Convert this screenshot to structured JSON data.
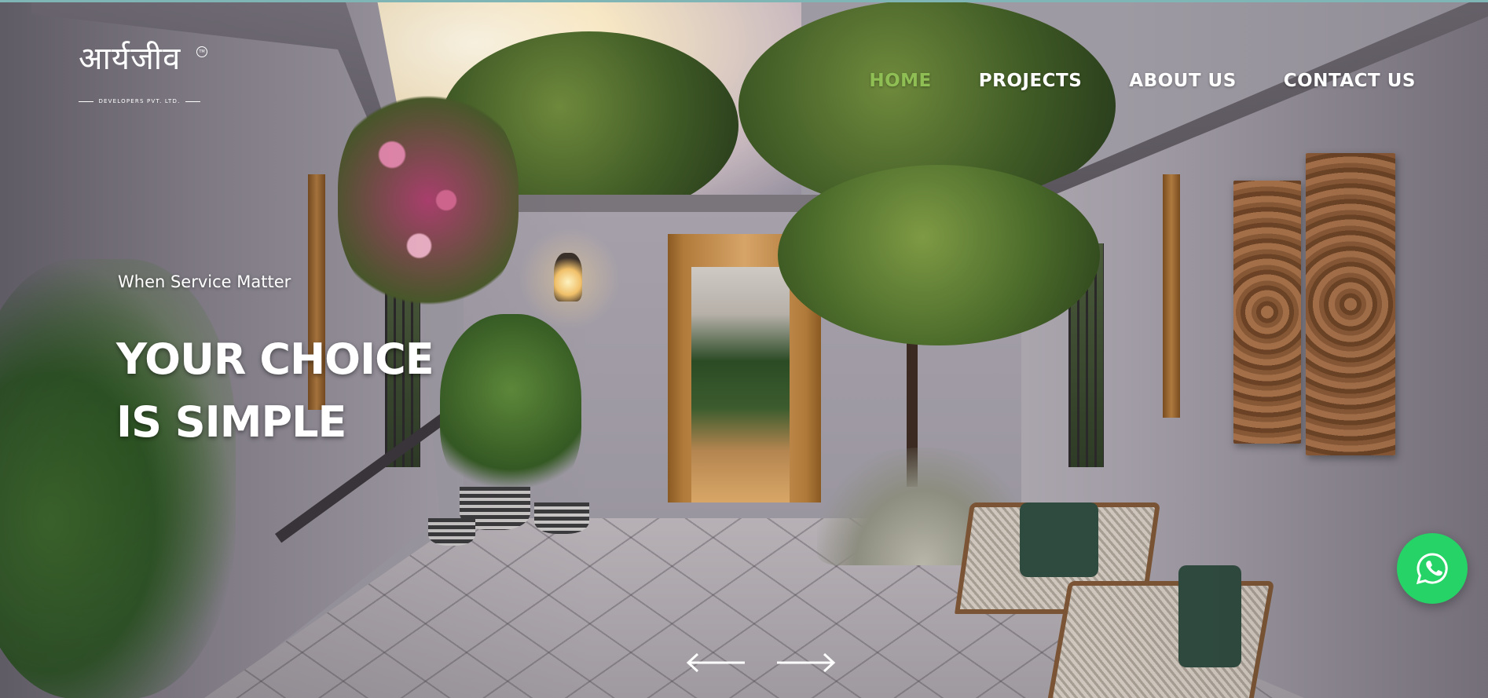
{
  "brand": {
    "logo_text": "आर्यजीव",
    "tagline": "DEVELOPERS PVT. LTD.",
    "trademark": "TM"
  },
  "nav": {
    "items": [
      {
        "label": "HOME",
        "active": true
      },
      {
        "label": "PROJECTS",
        "active": false
      },
      {
        "label": "ABOUT US",
        "active": false
      },
      {
        "label": "CONTACT US",
        "active": false
      }
    ],
    "active_color": "#8fbf54"
  },
  "hero": {
    "kicker": "When Service Matter",
    "title_line1": "YOUR CHOICE",
    "title_line2": "IS SIMPLE"
  },
  "slider": {
    "prev_icon": "arrow-left-icon",
    "next_icon": "arrow-right-icon"
  },
  "whatsapp": {
    "icon": "whatsapp-icon",
    "color": "#26d366"
  }
}
